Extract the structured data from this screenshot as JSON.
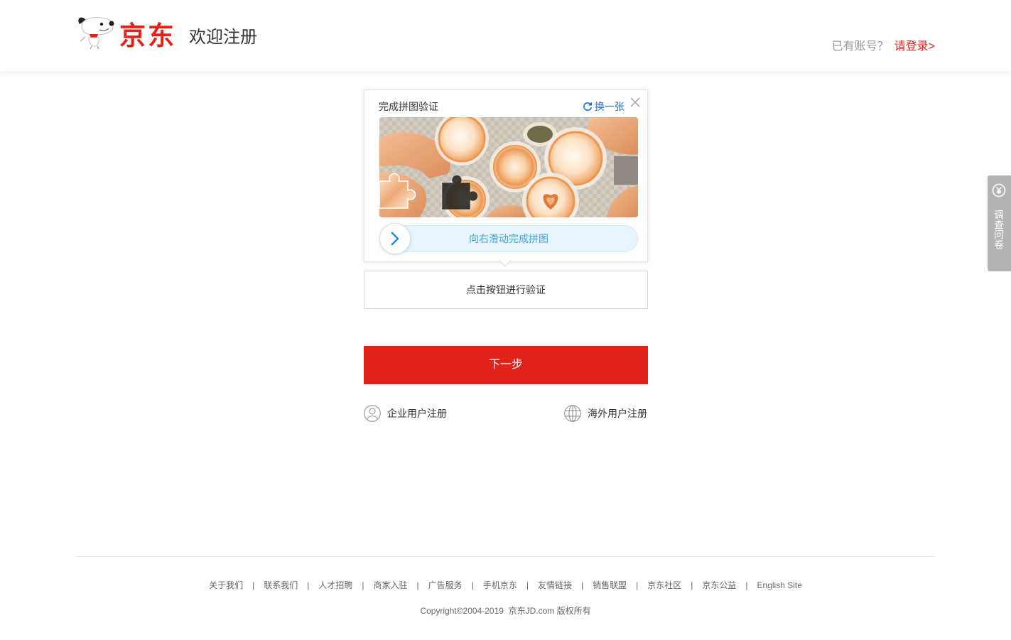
{
  "header": {
    "logo_text": "京东",
    "page_title": "欢迎注册",
    "has_account_text": "已有账号？",
    "login_link": "请登录>"
  },
  "captcha": {
    "title": "完成拼图验证",
    "refresh_label": "换一张",
    "slider_hint": "向右滑动完成拼图",
    "slider_progress": 0
  },
  "verify_button_label": "点击按钮进行验证",
  "next_button_label": "下一步",
  "alt_register": {
    "enterprise_label": "企业用户注册",
    "overseas_label": "海外用户注册"
  },
  "survey_tab": {
    "label": "调查问卷"
  },
  "footer": {
    "links": [
      "关于我们",
      "联系我们",
      "人才招聘",
      "商家入驻",
      "广告服务",
      "手机京东",
      "友情链接",
      "销售联盟",
      "京东社区",
      "京东公益",
      "English Site"
    ],
    "separator": "|",
    "copyright": "Copyright©2004-2019  京东JD.com 版权所有"
  },
  "icons": {
    "logo": "jd-mascot-icon",
    "refresh": "refresh-icon",
    "close": "close-icon",
    "slider_handle": "chevron-right-icon",
    "enterprise": "user-icon",
    "overseas": "globe-icon",
    "survey": "survey-icon"
  },
  "colors": {
    "brand_red": "#e2231a",
    "refresh_blue": "#1a6fcf",
    "slider_text": "#3ea4dc",
    "slider_track": "#e8f4fc",
    "muted_text": "#999999",
    "footer_text": "#666666",
    "survey_tab_bg": "#b3b3b3"
  }
}
